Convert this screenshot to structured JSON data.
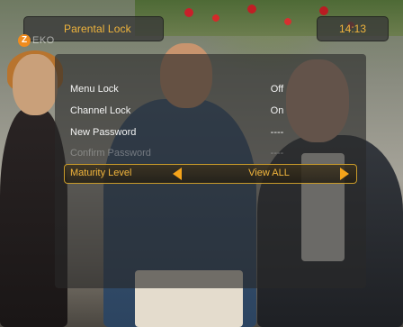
{
  "header": {
    "title": "Parental Lock",
    "logo_letter": "Z",
    "logo_text": "EKO",
    "clock": "14:13"
  },
  "menu": {
    "items": [
      {
        "label": "Menu Lock",
        "value": "Off",
        "enabled": true
      },
      {
        "label": "Channel Lock",
        "value": "On",
        "enabled": true
      },
      {
        "label": "New Password",
        "value": "----",
        "enabled": true
      },
      {
        "label": "Confirm Password",
        "value": "----",
        "enabled": false
      },
      {
        "label": "Maturity Level",
        "value": "View ALL",
        "enabled": true,
        "selected": true
      }
    ]
  },
  "colors": {
    "accent": "#f0b43c",
    "arrow": "#f5a41a",
    "selection_border": "#c89a2a"
  },
  "icons": {
    "prev": "left-triangle-icon",
    "next": "right-triangle-icon"
  }
}
